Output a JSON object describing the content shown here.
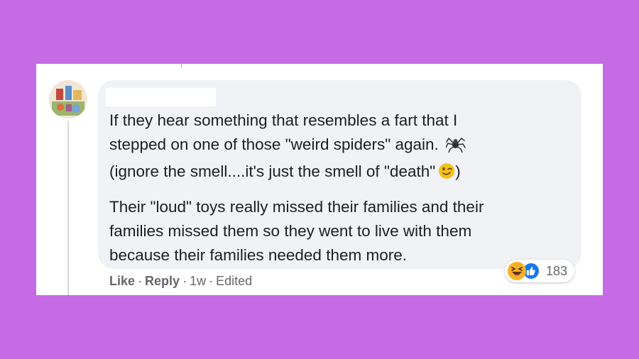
{
  "comment": {
    "paragraph1": {
      "line1": "If they hear something that resembles a fart that I",
      "line2": "stepped on one of those \"weird spiders\" again.",
      "line3_start": "(ignore the smell....it's just the smell of \"death\"",
      "line3_end": ")"
    },
    "paragraph2": {
      "line1": "Their \"loud\" toys really missed their families and their",
      "line2": "families missed them so they went to live with them",
      "line3": "because their families needed them more."
    },
    "icons": {
      "spider": "spider-icon",
      "wink": "winking-face-icon"
    }
  },
  "actions": {
    "like": "Like",
    "dot1": "·",
    "reply": "Reply",
    "dot2": "·",
    "age": "1w",
    "dot3": "·",
    "edited": "Edited"
  },
  "reactions": {
    "icons": [
      "haha-icon",
      "like-icon"
    ],
    "count": "183"
  },
  "colors": {
    "background": "#c56be3",
    "bubble": "#f0f2f5",
    "text": "#1c1e21",
    "secondary_text": "#65676b",
    "like_blue": "#1877f2",
    "haha_yellow": "#f7b125"
  }
}
